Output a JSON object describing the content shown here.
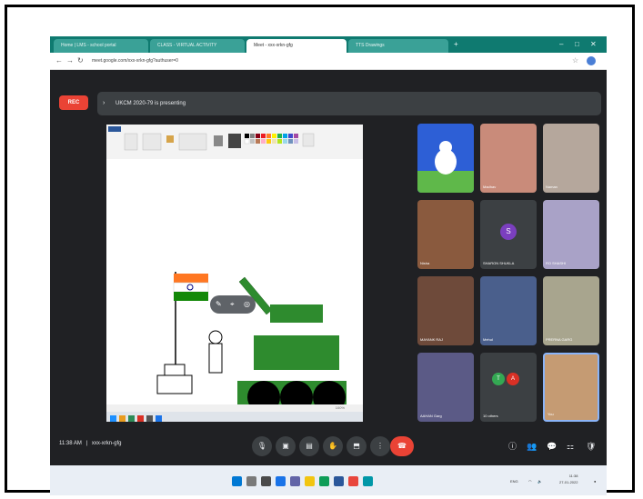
{
  "browser": {
    "tabs": [
      {
        "label": "Home | LMS - school portal"
      },
      {
        "label": "CLASS - VIRTUAL ACTIVITY"
      },
      {
        "label": "Meet - xxx-xrkn-gfg"
      },
      {
        "label": "TTS Drawings"
      }
    ],
    "new_tab_symbol": "+",
    "url": "meet.google.com/xxx-xrkn-gfg?authuser=0",
    "window_controls": [
      "–",
      "□",
      "✕"
    ]
  },
  "meet": {
    "rec_label": "REC",
    "presenting_text": "UKCM 2020-79 is presenting",
    "meeting_time": "11:38 AM",
    "meeting_code": "xxx-xrkn-gfg",
    "participants": [
      {
        "name": ""
      },
      {
        "name": "Madhav"
      },
      {
        "name": "Naman"
      },
      {
        "name": "Nisha"
      },
      {
        "name": "SHARON SHUKLA"
      },
      {
        "name": "RO SHASHI"
      },
      {
        "name": "MAYANK RAJ"
      },
      {
        "name": "Mehul"
      },
      {
        "name": "PRERNA GARG"
      },
      {
        "name": "AAHAN Garg"
      },
      {
        "name": "10 others"
      },
      {
        "name": "You"
      }
    ],
    "avatar_letter": "S",
    "others_badges": [
      "T",
      "A"
    ]
  },
  "paint": {
    "status_text": "100%"
  },
  "taskbar": {
    "tray_text": "ENG",
    "clock_time": "11:38",
    "clock_date": "27-01-2022"
  },
  "colors": {
    "accent_green": "#2e8b2e",
    "end_call_red": "#ea4335",
    "meet_bg": "#202124",
    "saffron": "#ff7722"
  }
}
